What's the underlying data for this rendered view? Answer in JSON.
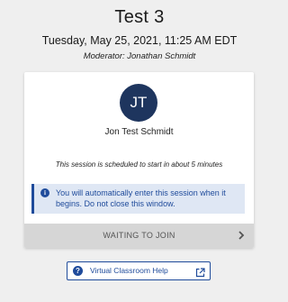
{
  "session": {
    "title": "Test 3",
    "datetime": "Tuesday, May 25, 2021, 11:25 AM EDT",
    "moderator": "Moderator: Jonathan Schmidt"
  },
  "user": {
    "initials": "JT",
    "name": "Jon Test Schmidt",
    "avatar_color": "#1e355e"
  },
  "status": {
    "schedule_text": "This session is scheduled to start in about 5 minutes",
    "notice_icon": "info-icon",
    "notice_text": "You will automatically enter this session when it begins. Do not close this window.",
    "waiting_label": "WAITING TO JOIN",
    "waiting_icon": "chevron-right-icon"
  },
  "help": {
    "icon": "question-icon",
    "label": "Virtual Classroom Help",
    "external_icon": "external-link-icon"
  },
  "colors": {
    "accent": "#1f4b9b",
    "notice_bg": "#dfe7f4",
    "page_bg": "#efefef",
    "waiting_bg": "#d6d6d6"
  }
}
